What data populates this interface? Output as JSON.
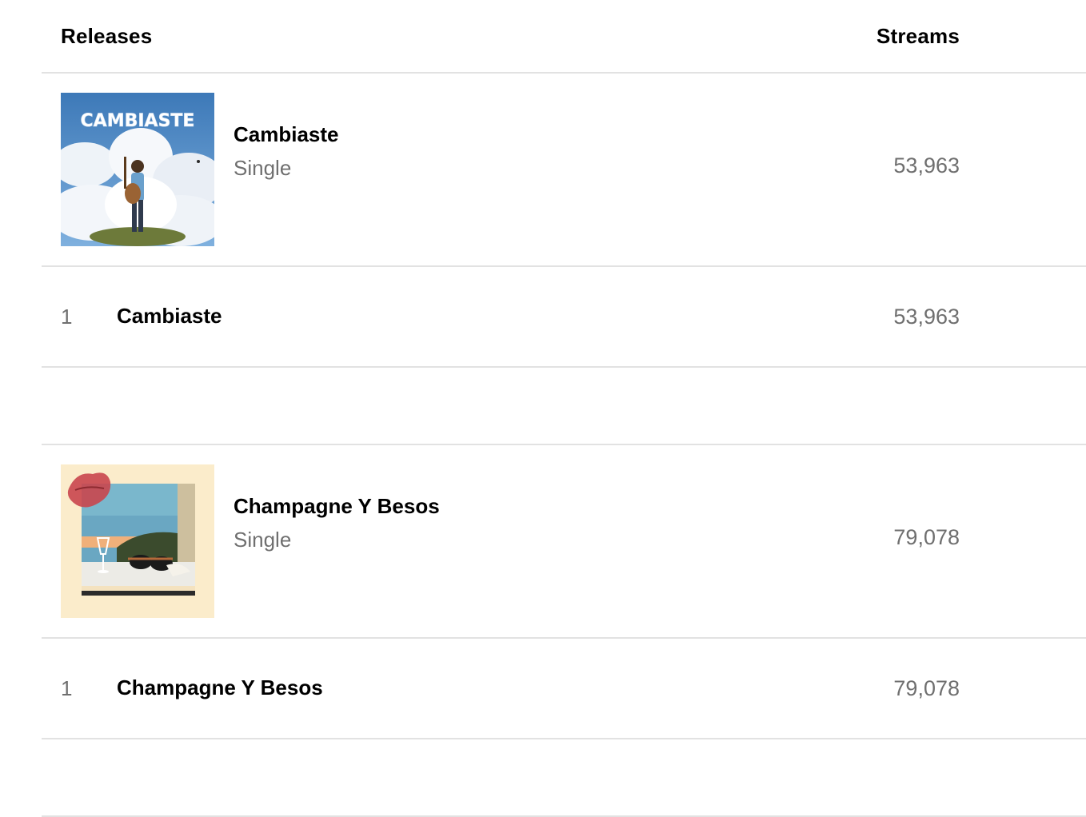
{
  "header": {
    "releases_label": "Releases",
    "streams_label": "Streams"
  },
  "releases": [
    {
      "title": "Cambiaste",
      "type": "Single",
      "streams": "53,963",
      "cover_text": "CAMBIASTE",
      "tracks": [
        {
          "number": "1",
          "title": "Cambiaste",
          "streams": "53,963"
        }
      ]
    },
    {
      "title": "Champagne Y Besos",
      "type": "Single",
      "streams": "79,078",
      "tracks": [
        {
          "number": "1",
          "title": "Champagne Y Besos",
          "streams": "79,078"
        }
      ]
    }
  ]
}
